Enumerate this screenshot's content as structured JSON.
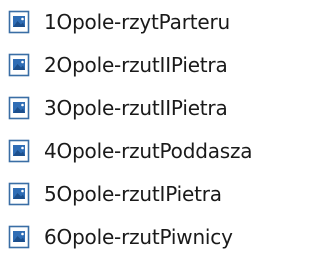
{
  "files": [
    {
      "name": "1Opole-rzytParteru",
      "icon": "image-file-icon"
    },
    {
      "name": "2Opole-rzutIIPietra",
      "icon": "image-file-icon"
    },
    {
      "name": "3Opole-rzutIIPietra",
      "icon": "image-file-icon"
    },
    {
      "name": "4Opole-rzutPoddasza",
      "icon": "image-file-icon"
    },
    {
      "name": "5Opole-rzutIPietra",
      "icon": "image-file-icon"
    },
    {
      "name": "6Opole-rzutPiwnicy",
      "icon": "image-file-icon"
    }
  ],
  "colors": {
    "icon_border": "#3a6ea5",
    "icon_fill": "#ffffff",
    "icon_picture": "#2f6db5",
    "text": "#1a1a1a"
  }
}
